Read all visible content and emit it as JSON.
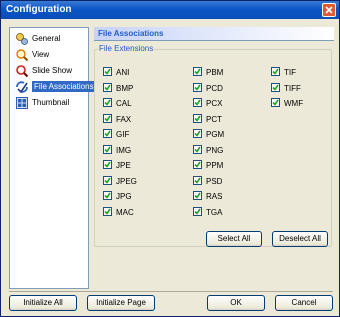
{
  "window": {
    "title": "Configuration"
  },
  "sidebar": {
    "items": [
      {
        "label": "General",
        "icon": "general-icon"
      },
      {
        "label": "View",
        "icon": "view-icon"
      },
      {
        "label": "Slide Show",
        "icon": "slideshow-icon"
      },
      {
        "label": "File Associations",
        "icon": "file-associations-icon",
        "selected": true
      },
      {
        "label": "Thumbnail",
        "icon": "thumbnail-icon"
      }
    ]
  },
  "panel": {
    "header": "File Associations",
    "group_title": "File Extensions",
    "extensions": {
      "col1": [
        "ANI",
        "BMP",
        "CAL",
        "FAX",
        "GIF",
        "IMG",
        "JPE",
        "JPEG",
        "JPG",
        "MAC"
      ],
      "col2": [
        "PBM",
        "PCD",
        "PCX",
        "PCT",
        "PGM",
        "PNG",
        "PPM",
        "PSD",
        "RAS",
        "TGA"
      ],
      "col3": [
        "TIF",
        "TIFF",
        "WMF"
      ]
    },
    "select_all": "Select All",
    "deselect_all": "Deselect All"
  },
  "footer": {
    "initialize_all": "Initialize All",
    "initialize_page": "Initialize Page",
    "ok": "OK",
    "cancel": "Cancel"
  },
  "colors": {
    "title_bar": "#0b55c7",
    "accent": "#215dc6",
    "selection": "#316ac5",
    "check": "#21a121"
  }
}
